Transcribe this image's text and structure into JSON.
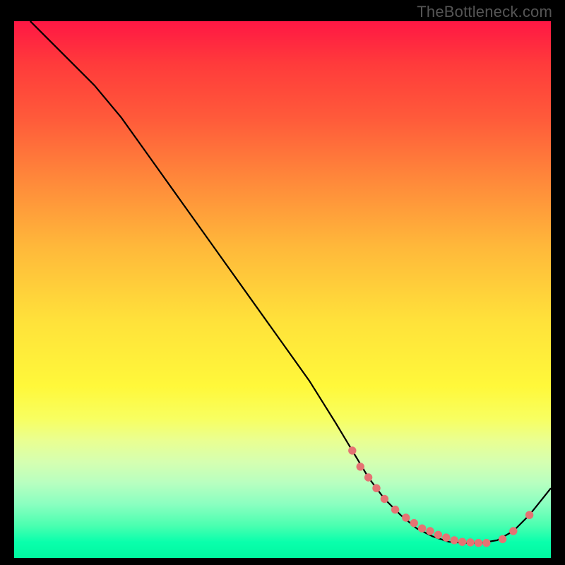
{
  "attribution": "TheBottleneck.com",
  "chart_data": {
    "type": "line",
    "title": "",
    "xlabel": "",
    "ylabel": "",
    "xlim": [
      0,
      100
    ],
    "ylim": [
      0,
      100
    ],
    "series": [
      {
        "name": "curve",
        "color": "#000000",
        "x": [
          3,
          6,
          10,
          15,
          20,
          25,
          30,
          35,
          40,
          45,
          50,
          55,
          60,
          63,
          66,
          69,
          72,
          75,
          78,
          81,
          84,
          87,
          90,
          93,
          96,
          100
        ],
        "y": [
          100,
          97,
          93,
          88,
          82,
          75,
          68,
          61,
          54,
          47,
          40,
          33,
          25,
          20,
          15,
          11,
          8,
          5.5,
          4,
          3,
          2.8,
          2.8,
          3.3,
          5,
          8,
          13
        ]
      }
    ],
    "highlight_points": {
      "name": "dots",
      "color": "#e57373",
      "radius_rel": 0.0075,
      "x": [
        63,
        64.5,
        66,
        67.5,
        69,
        71,
        73,
        74.5,
        76,
        77.5,
        79,
        80.5,
        82,
        83.5,
        85,
        86.5,
        88,
        91,
        93,
        96
      ],
      "y": [
        20,
        17,
        15,
        13,
        11,
        9,
        7.5,
        6.5,
        5.5,
        5,
        4.3,
        3.8,
        3.3,
        3,
        2.9,
        2.8,
        2.8,
        3.5,
        5,
        8
      ]
    },
    "background": "vertical-gradient",
    "gradient_stops": [
      {
        "pos": 0.0,
        "color": "#ff1744"
      },
      {
        "pos": 0.3,
        "color": "#ff8a3a"
      },
      {
        "pos": 0.6,
        "color": "#ffe23a"
      },
      {
        "pos": 0.8,
        "color": "#eaff90"
      },
      {
        "pos": 1.0,
        "color": "#00f7a0"
      }
    ]
  }
}
